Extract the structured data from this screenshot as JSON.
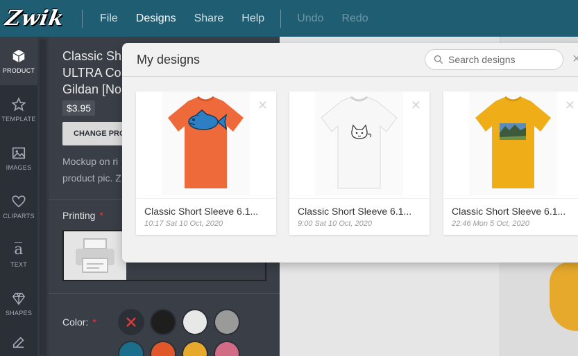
{
  "app": {
    "logo": "Zwik"
  },
  "menu": {
    "items": [
      {
        "label": "File",
        "state": "normal"
      },
      {
        "label": "Designs",
        "state": "active"
      },
      {
        "label": "Share",
        "state": "normal"
      },
      {
        "label": "Help",
        "state": "normal"
      }
    ],
    "undo": "Undo",
    "redo": "Redo"
  },
  "rail": [
    {
      "label": "PRODUCT",
      "icon": "cube-icon"
    },
    {
      "label": "TEMPLATE",
      "icon": "star-icon"
    },
    {
      "label": "IMAGES",
      "icon": "image-icon"
    },
    {
      "label": "CLIPARTS",
      "icon": "heart-icon"
    },
    {
      "label": "TEXT",
      "icon": "text-icon"
    },
    {
      "label": "SHAPES",
      "icon": "diamond-icon"
    }
  ],
  "product": {
    "title_line1": "Classic Sh",
    "title_line2": "ULTRA Co",
    "title_line3": "Gildan [No",
    "price": "$3.95",
    "change_button": "CHANGE PRO",
    "mockup_line1": "Mockup on ri",
    "mockup_line2": "product pic. Z",
    "printing_label": "Printing",
    "required_mark": "*",
    "color_label": "Color:"
  },
  "colors": {
    "brand": "#1f5d73",
    "swatches": [
      "#c0c0c0",
      "#1e1e1e",
      "#e8e8e8",
      "#9a9a9a",
      "#1b6e8c",
      "#e0572a",
      "#e6a92c",
      "#d16b86"
    ]
  },
  "modal": {
    "title": "My designs",
    "search_placeholder": "Search designs",
    "close": "×",
    "cards": [
      {
        "name": "Classic Short Sleeve 6.1...",
        "date": "10:17 Sat 10 Oct, 2020",
        "shirt_color": "#ef6a3a",
        "print": "fish"
      },
      {
        "name": "Classic Short Sleeve 6.1...",
        "date": "9:00 Sat 10 Oct, 2020",
        "shirt_color": "#f7f7f7",
        "print": "cat"
      },
      {
        "name": "Classic Short Sleeve 6.1...",
        "date": "22:46 Mon 5 Oct, 2020",
        "shirt_color": "#efae17",
        "print": "photo"
      }
    ]
  }
}
